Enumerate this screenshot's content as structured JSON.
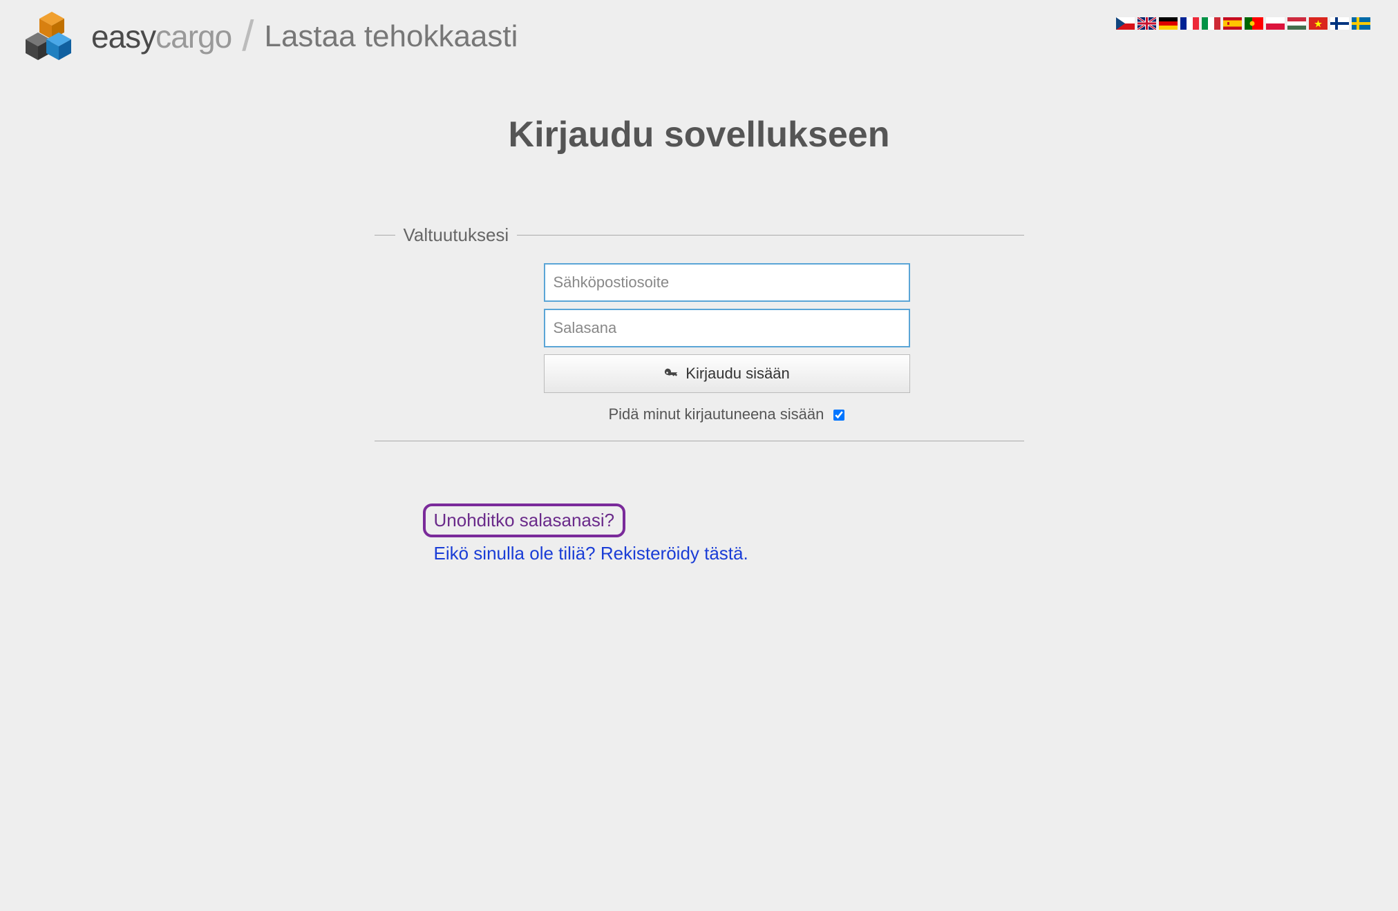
{
  "header": {
    "brand_easy": "easy",
    "brand_cargo": "cargo",
    "slash": "/",
    "tagline": "Lastaa tehokkaasti"
  },
  "flags": [
    {
      "name": "czech"
    },
    {
      "name": "english"
    },
    {
      "name": "german"
    },
    {
      "name": "french"
    },
    {
      "name": "italian"
    },
    {
      "name": "spanish"
    },
    {
      "name": "portuguese"
    },
    {
      "name": "polish"
    },
    {
      "name": "hungarian"
    },
    {
      "name": "vietnamese"
    },
    {
      "name": "finnish"
    },
    {
      "name": "swedish"
    }
  ],
  "page": {
    "title": "Kirjaudu sovellukseen",
    "credentials_label": "Valtuutuksesi"
  },
  "form": {
    "email_placeholder": "Sähköpostiosoite",
    "email_value": "",
    "password_placeholder": "Salasana",
    "password_value": "",
    "login_button": "Kirjaudu sisään",
    "keep_logged_label": "Pidä minut kirjautuneena sisään",
    "keep_logged_checked": true
  },
  "links": {
    "forgot_password": "Unohditko salasanasi?",
    "register": "Eikö sinulla ole tiliä? Rekisteröidy tästä."
  }
}
